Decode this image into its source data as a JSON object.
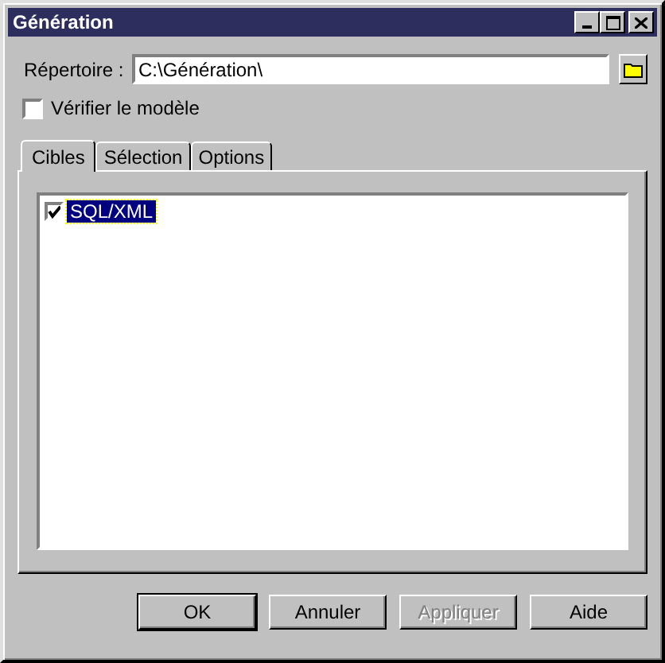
{
  "window": {
    "title": "Génération"
  },
  "directory": {
    "label": "Répertoire :",
    "value": "C:\\Génération\\"
  },
  "verify": {
    "label": "Vérifier le modèle",
    "checked": false
  },
  "tabs": [
    {
      "label": "Cibles",
      "selected": true
    },
    {
      "label": "Sélection",
      "selected": false
    },
    {
      "label": "Options",
      "selected": false
    }
  ],
  "targets": [
    {
      "label": "SQL/XML",
      "checked": true,
      "selected": true
    }
  ],
  "buttons": [
    {
      "label": "OK",
      "disabled": false,
      "default": true
    },
    {
      "label": "Annuler",
      "disabled": false,
      "default": false
    },
    {
      "label": "Appliquer",
      "disabled": true,
      "default": false
    },
    {
      "label": "Aide",
      "disabled": false,
      "default": false
    }
  ]
}
